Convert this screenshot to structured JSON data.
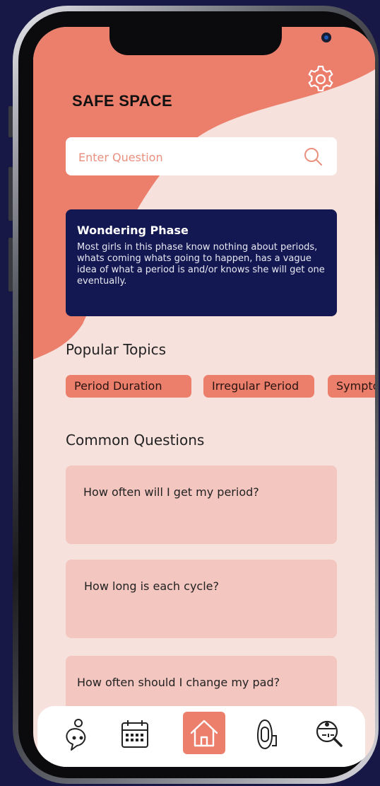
{
  "app": {
    "title": "SAFE SPACE"
  },
  "search": {
    "placeholder": "Enter Question"
  },
  "phase_card": {
    "title": "Wondering Phase",
    "body": "Most girls in this phase know nothing about periods, whats coming whats going to happen, has a vague idea of what a period is and/or knows she will get one eventually."
  },
  "popular": {
    "heading": "Popular Topics",
    "topics": [
      "Period Duration",
      "Irregular Period",
      "Symptoms"
    ]
  },
  "common": {
    "heading": "Common Questions",
    "questions": [
      "How often will I get my period?",
      "How long is each cycle?",
      "How often should I change my pad?"
    ]
  },
  "nav": {
    "items": [
      "chat-bubble-icon",
      "calendar-icon",
      "home-icon",
      "pad-icon",
      "doctor-search-icon"
    ],
    "active": "home-icon"
  },
  "colors": {
    "accent": "#EC7F6C",
    "background": "#F7E1DC",
    "card_navy": "#141852",
    "question_card": "#F3C6C0"
  }
}
